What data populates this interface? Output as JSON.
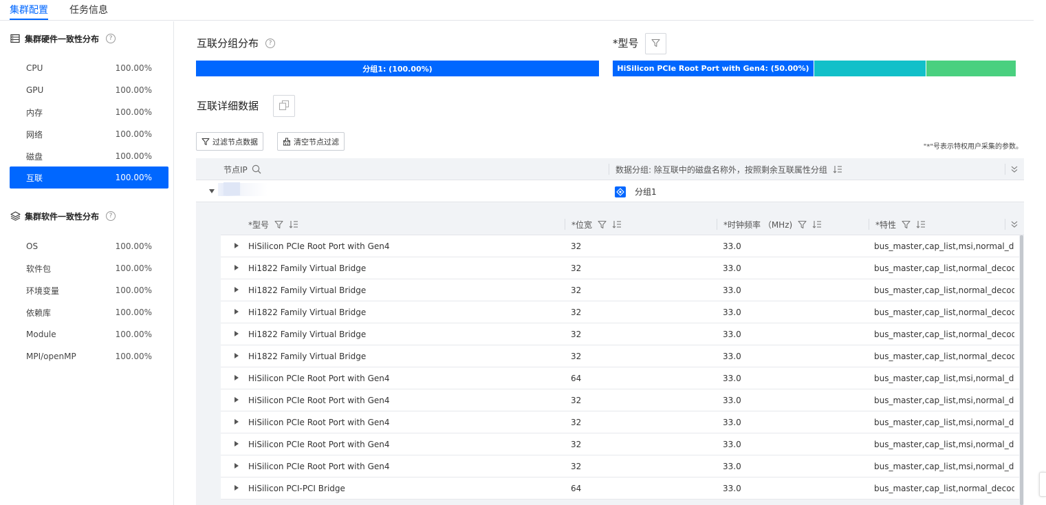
{
  "tabs": [
    {
      "label": "集群配置",
      "active": true
    },
    {
      "label": "任务信息",
      "active": false
    }
  ],
  "sidebar": {
    "hardware_title": "集群硬件一致性分布",
    "hardware_items": [
      {
        "label": "CPU",
        "value": "100.00%",
        "active": false
      },
      {
        "label": "GPU",
        "value": "100.00%",
        "active": false
      },
      {
        "label": "内存",
        "value": "100.00%",
        "active": false
      },
      {
        "label": "网络",
        "value": "100.00%",
        "active": false
      },
      {
        "label": "磁盘",
        "value": "100.00%",
        "active": false
      },
      {
        "label": "互联",
        "value": "100.00%",
        "active": true
      }
    ],
    "software_title": "集群软件一致性分布",
    "software_items": [
      {
        "label": "OS",
        "value": "100.00%"
      },
      {
        "label": "软件包",
        "value": "100.00%"
      },
      {
        "label": "环境变量",
        "value": "100.00%"
      },
      {
        "label": "依赖库",
        "value": "100.00%"
      },
      {
        "label": "Module",
        "value": "100.00%"
      },
      {
        "label": "MPI/openMP",
        "value": "100.00%"
      }
    ]
  },
  "main": {
    "group_dist_title": "互联分组分布",
    "model_title": "*型号",
    "group_bar": {
      "label": "分组1: (100.00%)",
      "percent": 100,
      "color": "#0067ff"
    },
    "model_bar": [
      {
        "label": "HiSilicon PCIe Root Port with Gen4: (50.00%)",
        "percent": 50,
        "color": "#0067ff"
      },
      {
        "label": "",
        "percent": 28,
        "color": "#12c0c9"
      },
      {
        "label": "",
        "percent": 22,
        "color": "#4ad07f"
      }
    ],
    "detail_title": "互联详细数据",
    "filter_btn": "过滤节点数据",
    "clear_btn": "清空节点过滤",
    "note": "\"*\"号表示特权用户采集的参数。",
    "outer_table": {
      "col_ip": "节点IP",
      "col_group": "数据分组: 除互联中的磁盘名称外，按照剩余互联属性分组",
      "row_group": "分组1"
    },
    "inner_table": {
      "headers": [
        "*型号",
        "*位宽",
        "*时钟频率 （MHz)",
        "*特性"
      ],
      "rows": [
        [
          "HiSilicon PCIe Root Port with Gen4",
          "32",
          "33.0",
          "bus_master,cap_list,msi,normal_deco..."
        ],
        [
          "Hi1822 Family Virtual Bridge",
          "32",
          "33.0",
          "bus_master,cap_list,normal_decode,p..."
        ],
        [
          "Hi1822 Family Virtual Bridge",
          "32",
          "33.0",
          "bus_master,cap_list,normal_decode,p..."
        ],
        [
          "Hi1822 Family Virtual Bridge",
          "32",
          "33.0",
          "bus_master,cap_list,normal_decode,p..."
        ],
        [
          "Hi1822 Family Virtual Bridge",
          "32",
          "33.0",
          "bus_master,cap_list,normal_decode,p..."
        ],
        [
          "Hi1822 Family Virtual Bridge",
          "32",
          "33.0",
          "bus_master,cap_list,normal_decode,p..."
        ],
        [
          "HiSilicon PCIe Root Port with Gen4",
          "64",
          "33.0",
          "bus_master,cap_list,msi,normal_deco..."
        ],
        [
          "HiSilicon PCIe Root Port with Gen4",
          "32",
          "33.0",
          "bus_master,cap_list,msi,normal_deco..."
        ],
        [
          "HiSilicon PCIe Root Port with Gen4",
          "32",
          "33.0",
          "bus_master,cap_list,msi,normal_deco..."
        ],
        [
          "HiSilicon PCIe Root Port with Gen4",
          "32",
          "33.0",
          "bus_master,cap_list,msi,normal_deco..."
        ],
        [
          "HiSilicon PCIe Root Port with Gen4",
          "32",
          "33.0",
          "bus_master,cap_list,msi,normal_deco..."
        ],
        [
          "HiSilicon PCI-PCI Bridge",
          "64",
          "33.0",
          "bus_master,cap_list,normal_decode,p..."
        ]
      ]
    }
  }
}
